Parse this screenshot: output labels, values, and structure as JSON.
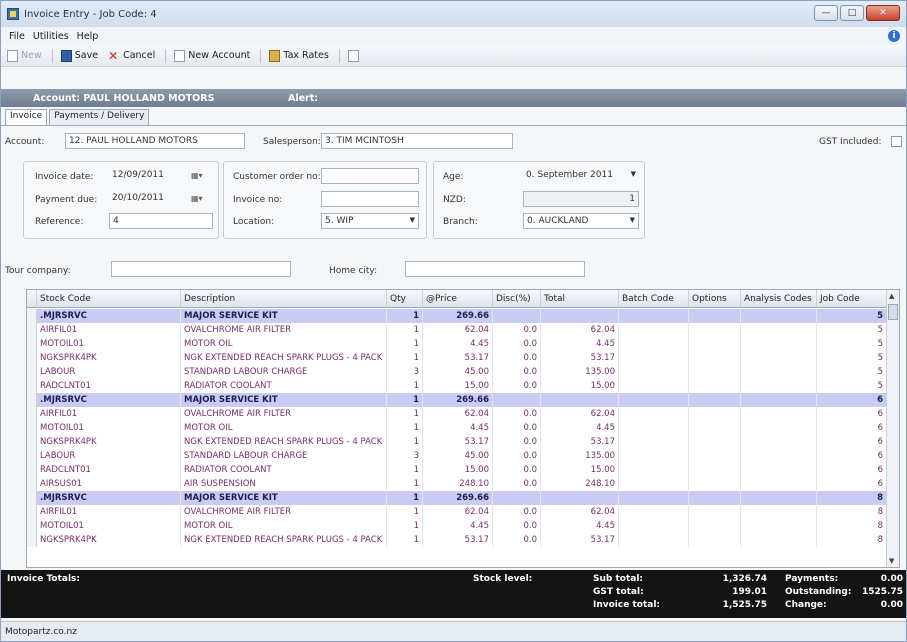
{
  "window": {
    "title": "Invoice Entry - Job Code: 4",
    "minimize": "—",
    "maximize": "□",
    "close": "✕"
  },
  "menu": [
    "File",
    "Utilities",
    "Help"
  ],
  "help_glyph": "i",
  "toolbar": {
    "new": "New",
    "save": "Save",
    "cancel": "Cancel",
    "new_account": "New Account",
    "tax_rates": "Tax Rates"
  },
  "header": {
    "account": "Account: PAUL HOLLAND MOTORS",
    "alert": "Alert:"
  },
  "tabs": [
    "Invoice",
    "Payments / Delivery"
  ],
  "form": {
    "account_label": "Account:",
    "account_value": "12. PAUL HOLLAND MOTORS",
    "salesperson_label": "Salesperson:",
    "salesperson_value": "3. TIM MCINTOSH",
    "gst_label": "GST Included:",
    "invoice_date_label": "Invoice date:",
    "invoice_date": "12/09/2011",
    "payment_due_label": "Payment due:",
    "payment_due": "20/10/2011",
    "reference_label": "Reference:",
    "reference": "4",
    "customer_order_label": "Customer order no:",
    "customer_order": "",
    "invoice_no_label": "Invoice no:",
    "invoice_no": "",
    "location_label": "Location:",
    "location": "5. WIP",
    "age_label": "Age:",
    "age": "0. September 2011",
    "nzd_label": "NZD:",
    "nzd": "1",
    "branch_label": "Branch:",
    "branch": "0. AUCKLAND",
    "tour_company_label": "Tour company:",
    "tour_company": "",
    "home_city_label": "Home city:",
    "home_city": ""
  },
  "grid": {
    "columns": [
      "Stock Code",
      "Description",
      "Qty",
      "@Price",
      "Disc(%)",
      "Total",
      "Batch Code",
      "Options",
      "Analysis Codes",
      "Job Code"
    ],
    "rows": [
      {
        "kit": true,
        "code": ".MJRSRVC",
        "desc": "MAJOR SERVICE KIT",
        "qty": "1",
        "price": "269.66",
        "disc": "",
        "total": "",
        "job": "5"
      },
      {
        "kit": false,
        "code": "AIRFIL01",
        "desc": "OVALCHROME AIR FILTER",
        "qty": "1",
        "price": "62.04",
        "disc": "0.0",
        "total": "62.04",
        "job": "5"
      },
      {
        "kit": false,
        "code": "MOTOIL01",
        "desc": "MOTOR OIL",
        "qty": "1",
        "price": "4.45",
        "disc": "0.0",
        "total": "4.45",
        "job": "5"
      },
      {
        "kit": false,
        "code": "NGKSPRK4PK",
        "desc": "NGK EXTENDED REACH SPARK PLUGS - 4 PACK",
        "qty": "1",
        "price": "53.17",
        "disc": "0.0",
        "total": "53.17",
        "job": "5"
      },
      {
        "kit": false,
        "code": "LABOUR",
        "desc": "STANDARD LABOUR CHARGE",
        "qty": "3",
        "price": "45.00",
        "disc": "0.0",
        "total": "135.00",
        "job": "5"
      },
      {
        "kit": false,
        "code": "RADCLNT01",
        "desc": "RADIATOR COOLANT",
        "qty": "1",
        "price": "15.00",
        "disc": "0.0",
        "total": "15.00",
        "job": "5"
      },
      {
        "kit": true,
        "code": ".MJRSRVC",
        "desc": "MAJOR SERVICE KIT",
        "qty": "1",
        "price": "269.66",
        "disc": "",
        "total": "",
        "job": "6"
      },
      {
        "kit": false,
        "code": "AIRFIL01",
        "desc": "OVALCHROME AIR FILTER",
        "qty": "1",
        "price": "62.04",
        "disc": "0.0",
        "total": "62.04",
        "job": "6"
      },
      {
        "kit": false,
        "code": "MOTOIL01",
        "desc": "MOTOR OIL",
        "qty": "1",
        "price": "4.45",
        "disc": "0.0",
        "total": "4.45",
        "job": "6"
      },
      {
        "kit": false,
        "code": "NGKSPRK4PK",
        "desc": "NGK EXTENDED REACH SPARK PLUGS - 4 PACK",
        "qty": "1",
        "price": "53.17",
        "disc": "0.0",
        "total": "53.17",
        "job": "6"
      },
      {
        "kit": false,
        "code": "LABOUR",
        "desc": "STANDARD LABOUR CHARGE",
        "qty": "3",
        "price": "45.00",
        "disc": "0.0",
        "total": "135.00",
        "job": "6"
      },
      {
        "kit": false,
        "code": "RADCLNT01",
        "desc": "RADIATOR COOLANT",
        "qty": "1",
        "price": "15.00",
        "disc": "0.0",
        "total": "15.00",
        "job": "6"
      },
      {
        "kit": false,
        "code": "AIRSUS01",
        "desc": "AIR SUSPENSION",
        "qty": "1",
        "price": "248.10",
        "disc": "0.0",
        "total": "248.10",
        "job": "6"
      },
      {
        "kit": true,
        "code": ".MJRSRVC",
        "desc": "MAJOR SERVICE KIT",
        "qty": "1",
        "price": "269.66",
        "disc": "",
        "total": "",
        "job": "8"
      },
      {
        "kit": false,
        "code": "AIRFIL01",
        "desc": "OVALCHROME AIR FILTER",
        "qty": "1",
        "price": "62.04",
        "disc": "0.0",
        "total": "62.04",
        "job": "8"
      },
      {
        "kit": false,
        "code": "MOTOIL01",
        "desc": "MOTOR OIL",
        "qty": "1",
        "price": "4.45",
        "disc": "0.0",
        "total": "4.45",
        "job": "8"
      },
      {
        "kit": false,
        "code": "NGKSPRK4PK",
        "desc": "NGK EXTENDED REACH SPARK PLUGS - 4 PACK",
        "qty": "1",
        "price": "53.17",
        "disc": "0.0",
        "total": "53.17",
        "job": "8"
      }
    ]
  },
  "totals": {
    "title": "Invoice Totals:",
    "stock_level": "Stock level:",
    "sub_total_label": "Sub total:",
    "sub_total": "1,326.74",
    "gst_total_label": "GST total:",
    "gst_total": "199.01",
    "invoice_total_label": "Invoice total:",
    "invoice_total": "1,525.75",
    "payments_label": "Payments:",
    "payments": "0.00",
    "outstanding_label": "Outstanding:",
    "outstanding": "1525.75",
    "change_label": "Change:",
    "change": "0.00"
  },
  "status": "Motopartz.co.nz"
}
